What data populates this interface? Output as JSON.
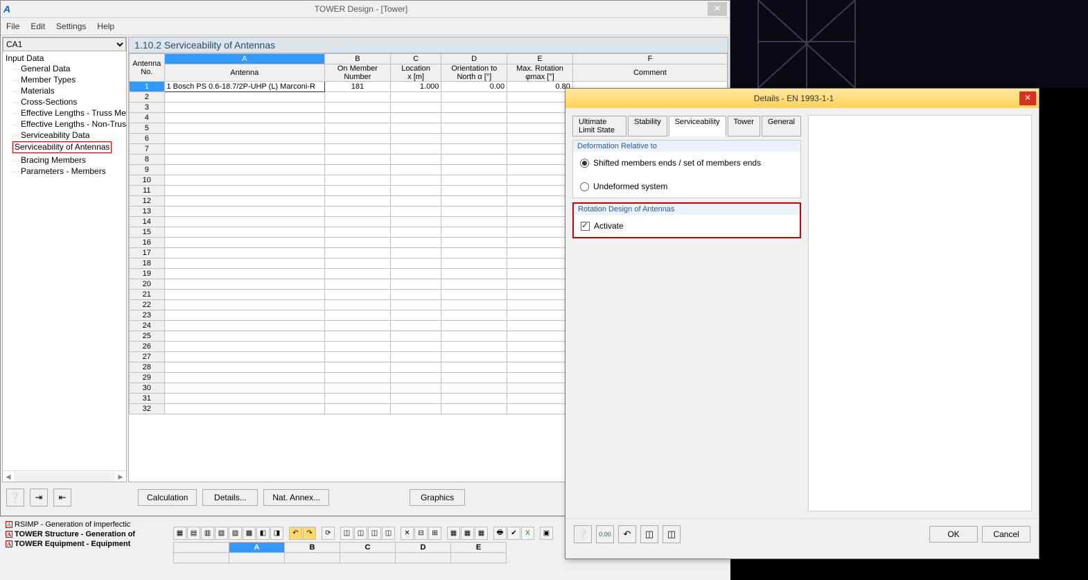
{
  "main": {
    "title": "TOWER Design - [Tower]",
    "menus": [
      "File",
      "Edit",
      "Settings",
      "Help"
    ],
    "combo": "CA1",
    "tree_root": "Input Data",
    "tree": [
      "General Data",
      "Member Types",
      "Materials",
      "Cross-Sections",
      "Effective Lengths - Truss Members",
      "Effective Lengths - Non-Truss Members",
      "Serviceability Data",
      "Serviceability of Antennas",
      "Bracing Members",
      "Parameters - Members"
    ],
    "tree_selected_index": 7,
    "section_title": "1.10.2 Serviceability of Antennas",
    "col_letters": [
      "A",
      "B",
      "C",
      "D",
      "E",
      "F"
    ],
    "row_header_top": "Antenna",
    "row_header_bot": "No.",
    "columns": [
      "Antenna",
      "On Member Number",
      "Location x [m]",
      "Orientation to North α [°]",
      "Max. Rotation φmax [°]",
      "Comment"
    ],
    "rows": 32,
    "data_row": {
      "no": "1",
      "antenna": "1 Bosch PS 0.6-18.7/2P-UHP (L) Marconi-R",
      "member": "181",
      "x": "1.000",
      "orient": "0.00",
      "maxrot": "0.80",
      "comment": ""
    },
    "buttons": {
      "calc": "Calculation",
      "details": "Details...",
      "nat": "Nat. Annex...",
      "graphics": "Graphics"
    }
  },
  "bottom": {
    "items": [
      "RSIMP - Generation of imperfectic",
      "TOWER Structure - Generation of",
      "TOWER Equipment - Equipment"
    ],
    "mini_cols": [
      "A",
      "B",
      "C",
      "D",
      "E"
    ]
  },
  "dialog": {
    "title": "Details - EN 1993-1-1",
    "tabs": [
      "Ultimate Limit State",
      "Stability",
      "Serviceability",
      "Tower",
      "General"
    ],
    "active_tab": 2,
    "group1_title": "Deformation Relative to",
    "radio1": "Shifted members ends / set of members ends",
    "radio2": "Undeformed system",
    "radio_selected": 0,
    "group2_title": "Rotation Design of Antennas",
    "check_label": "Activate",
    "check_checked": true,
    "ok": "OK",
    "cancel": "Cancel"
  }
}
